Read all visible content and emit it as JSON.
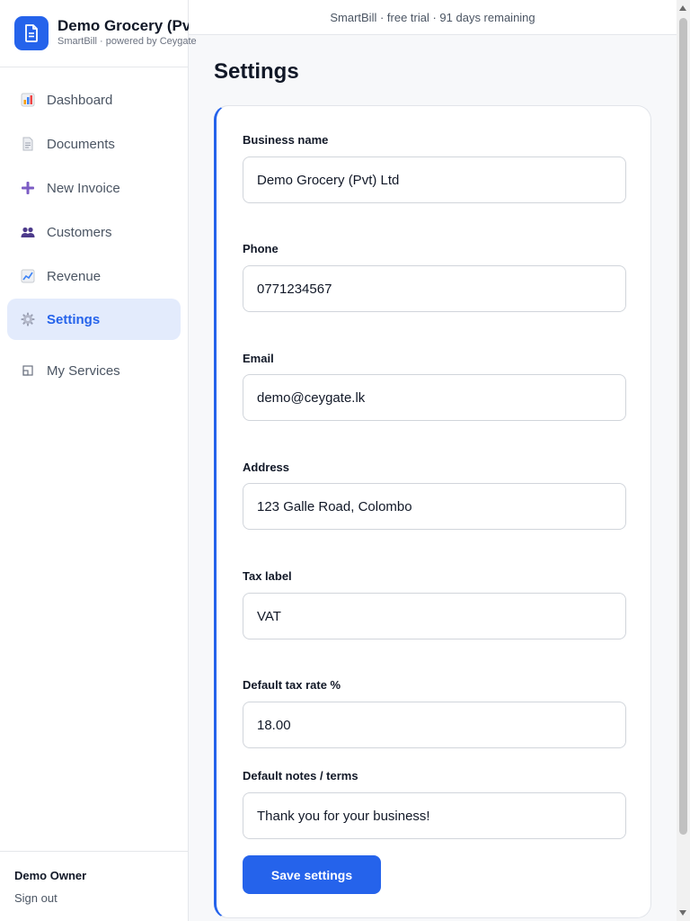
{
  "brand": {
    "name": "Demo Grocery (Pvt) Ltd",
    "subtitle": "SmartBill · powered by Ceygate",
    "logo_icon": "document-icon",
    "accent": "#2563eb"
  },
  "topbar": {
    "trial_text": "SmartBill · free trial · 91 days remaining"
  },
  "sidebar": {
    "items": [
      {
        "label": "Dashboard",
        "icon": "bar-chart-icon",
        "active": false
      },
      {
        "label": "Documents",
        "icon": "document-icon",
        "active": false
      },
      {
        "label": "New Invoice",
        "icon": "plus-icon",
        "active": false
      },
      {
        "label": "Customers",
        "icon": "users-icon",
        "active": false
      },
      {
        "label": "Revenue",
        "icon": "line-chart-icon",
        "active": false
      },
      {
        "label": "Settings",
        "icon": "gear-icon",
        "active": true
      },
      {
        "label": "My Services",
        "icon": "services-icon",
        "active": false
      }
    ],
    "footer": {
      "owner_name": "Demo Owner",
      "sign_out_label": "Sign out"
    }
  },
  "main": {
    "title": "Settings",
    "form": {
      "business_name": {
        "label": "Business name",
        "value": "Demo Grocery (Pvt) Ltd"
      },
      "phone": {
        "label": "Phone",
        "value": "0771234567"
      },
      "email": {
        "label": "Email",
        "value": "demo@ceygate.lk"
      },
      "address": {
        "label": "Address",
        "value": "123 Galle Road, Colombo"
      },
      "tax_label": {
        "label": "Tax label",
        "value": "VAT"
      },
      "tax_rate": {
        "label": "Default tax rate %",
        "value": "18.00"
      },
      "notes": {
        "label": "Default notes / terms",
        "value": "Thank you for your business!"
      },
      "save_label": "Save settings"
    }
  }
}
